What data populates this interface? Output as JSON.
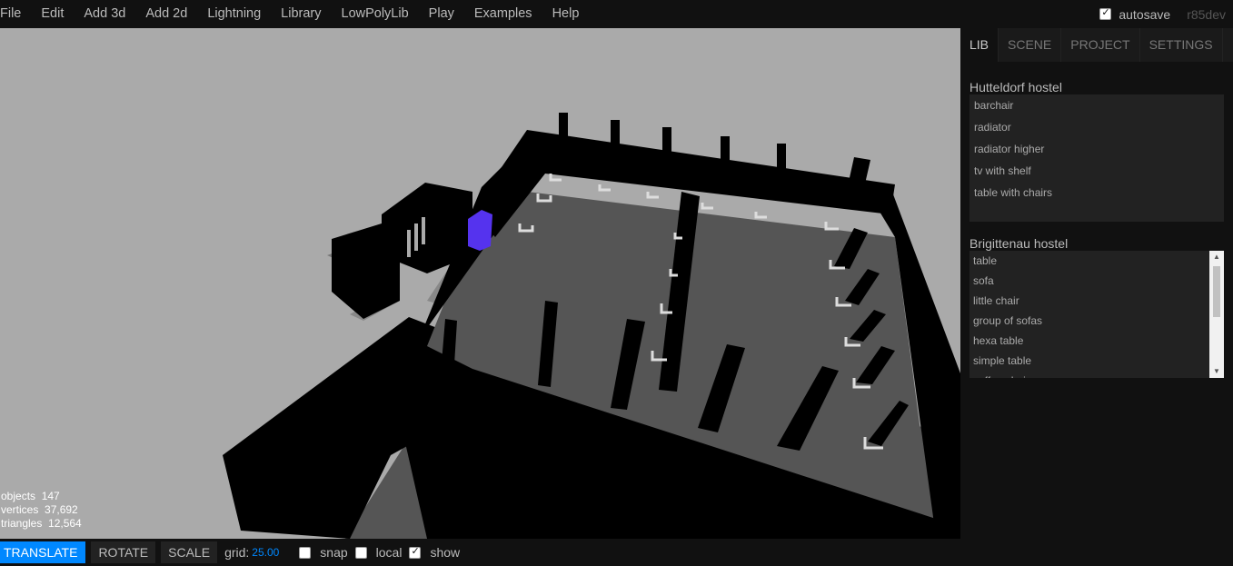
{
  "menubar": {
    "items": [
      "File",
      "Edit",
      "Add 3d",
      "Add 2d",
      "Lightning",
      "Library",
      "LowPolyLib",
      "Play",
      "Examples",
      "Help"
    ],
    "autosave_label": "autosave",
    "autosave_checked": true,
    "version": "r85dev"
  },
  "viewport": {
    "background": "#aaaaaa",
    "selected_color": "#5533ee",
    "info": {
      "objects_label": "objects",
      "objects": "147",
      "vertices_label": "vertices",
      "vertices": "37,692",
      "triangles_label": "triangles",
      "triangles": "12,564"
    }
  },
  "toolbar": {
    "translate": "TRANSLATE",
    "rotate": "ROTATE",
    "scale": "SCALE",
    "grid_label": "grid:",
    "grid_value": "25.00",
    "snap_label": "snap",
    "local_label": "local",
    "show_label": "show",
    "snap_checked": false,
    "local_checked": false,
    "show_checked": true,
    "accent": "#0088ff"
  },
  "sidebar": {
    "tabs": [
      "LIB",
      "SCENE",
      "PROJECT",
      "SETTINGS"
    ],
    "selected_tab": "LIB",
    "libraries": [
      {
        "title": "Hutteldorf hostel",
        "items": [
          "barchair",
          "radiator",
          "radiator higher",
          "tv with shelf",
          "table with chairs"
        ]
      },
      {
        "title": "Brigittenau hostel",
        "items": [
          "table",
          "sofa",
          "little chair",
          "group of sofas",
          "hexa table",
          "simple table",
          "coffee chair"
        ]
      }
    ]
  }
}
